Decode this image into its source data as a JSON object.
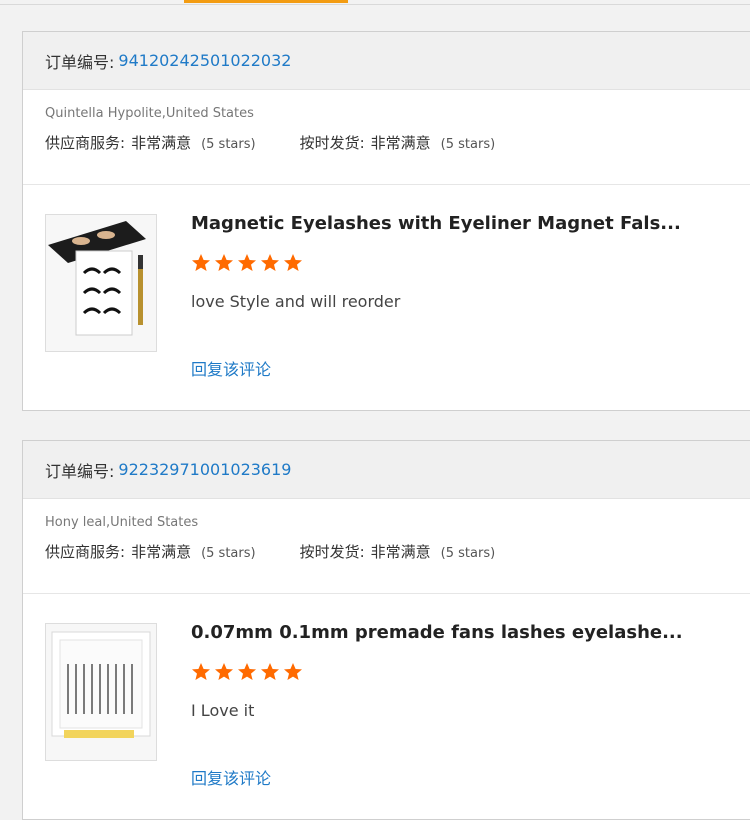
{
  "colors": {
    "accent": "#f39c12",
    "link": "#1f7ac7",
    "star": "#ff6a00"
  },
  "reviews": [
    {
      "order_label": "订单编号:",
      "order_number": "94120242501022032",
      "buyer": "Quintella Hypolite,United States",
      "supplier_service_label": "供应商服务:",
      "supplier_service_value": "非常满意",
      "supplier_service_stars": "(5 stars)",
      "on_time_label": "按时发货:",
      "on_time_value": "非常满意",
      "on_time_stars": "(5 stars)",
      "product_title": "Magnetic Eyelashes with Eyeliner Magnet Fals...",
      "rating": 5,
      "comment": "love Style and will reorder",
      "reply_label": "回复该评论",
      "thumb_icon": "eyelash-kit-image"
    },
    {
      "order_label": "订单编号:",
      "order_number": "92232971001023619",
      "buyer": "Hony leal,United States",
      "supplier_service_label": "供应商服务:",
      "supplier_service_value": "非常满意",
      "supplier_service_stars": "(5 stars)",
      "on_time_label": "按时发货:",
      "on_time_value": "非常满意",
      "on_time_stars": "(5 stars)",
      "product_title": "0.07mm 0.1mm premade fans lashes eyelashe...",
      "rating": 5,
      "comment": "I Love it",
      "reply_label": "回复该评论",
      "thumb_icon": "lash-tray-image"
    }
  ]
}
